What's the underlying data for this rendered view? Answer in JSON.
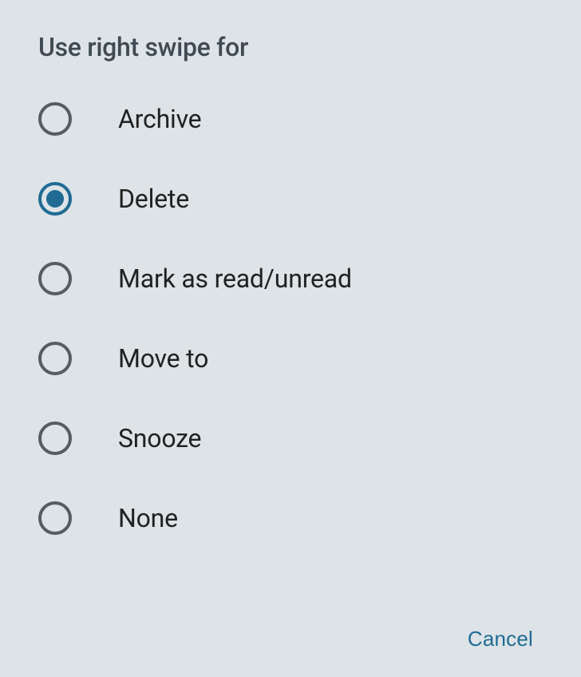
{
  "title": "Use right swipe for",
  "options": [
    {
      "id": "archive",
      "label": "Archive",
      "selected": false
    },
    {
      "id": "delete",
      "label": "Delete",
      "selected": true
    },
    {
      "id": "mark-read-unread",
      "label": "Mark as read/unread",
      "selected": false
    },
    {
      "id": "move-to",
      "label": "Move to",
      "selected": false
    },
    {
      "id": "snooze",
      "label": "Snooze",
      "selected": false
    },
    {
      "id": "none",
      "label": "None",
      "selected": false
    }
  ],
  "cancel_label": "Cancel"
}
